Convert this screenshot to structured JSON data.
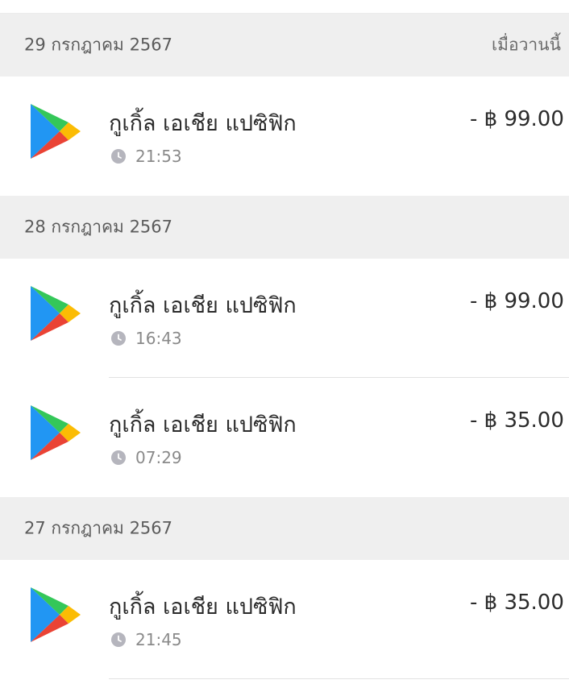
{
  "groups": [
    {
      "date": "29 กรกฎาคม 2567",
      "relative": "เมื่อวานนี้",
      "transactions": [
        {
          "merchant": "กูเกิ้ล เอเชีย แปซิฟิก",
          "time": "21:53",
          "amount": "- ฿ 99.00",
          "icon": "google-play-icon"
        }
      ]
    },
    {
      "date": "28 กรกฎาคม 2567",
      "transactions": [
        {
          "merchant": "กูเกิ้ล เอเชีย แปซิฟิก",
          "time": "16:43",
          "amount": "- ฿ 99.00",
          "icon": "google-play-icon"
        },
        {
          "merchant": "กูเกิ้ล เอเชีย แปซิฟิก",
          "time": "07:29",
          "amount": "- ฿ 35.00",
          "icon": "google-play-icon"
        }
      ]
    },
    {
      "date": "27 กรกฎาคม 2567",
      "transactions": [
        {
          "merchant": "กูเกิ้ล เอเชีย แปซิฟิก",
          "time": "21:45",
          "amount": "- ฿ 35.00",
          "icon": "google-play-icon"
        }
      ]
    }
  ],
  "colors": {
    "header_bg": "#efefef",
    "text_primary": "#2b2b2b",
    "text_secondary": "#8a8a8a",
    "clock_icon": "#b5b5bd",
    "divider": "#e2e2e2",
    "play_blue": "#2196f3",
    "play_green": "#34c759",
    "play_yellow": "#fbbc04",
    "play_red": "#ea4335"
  }
}
